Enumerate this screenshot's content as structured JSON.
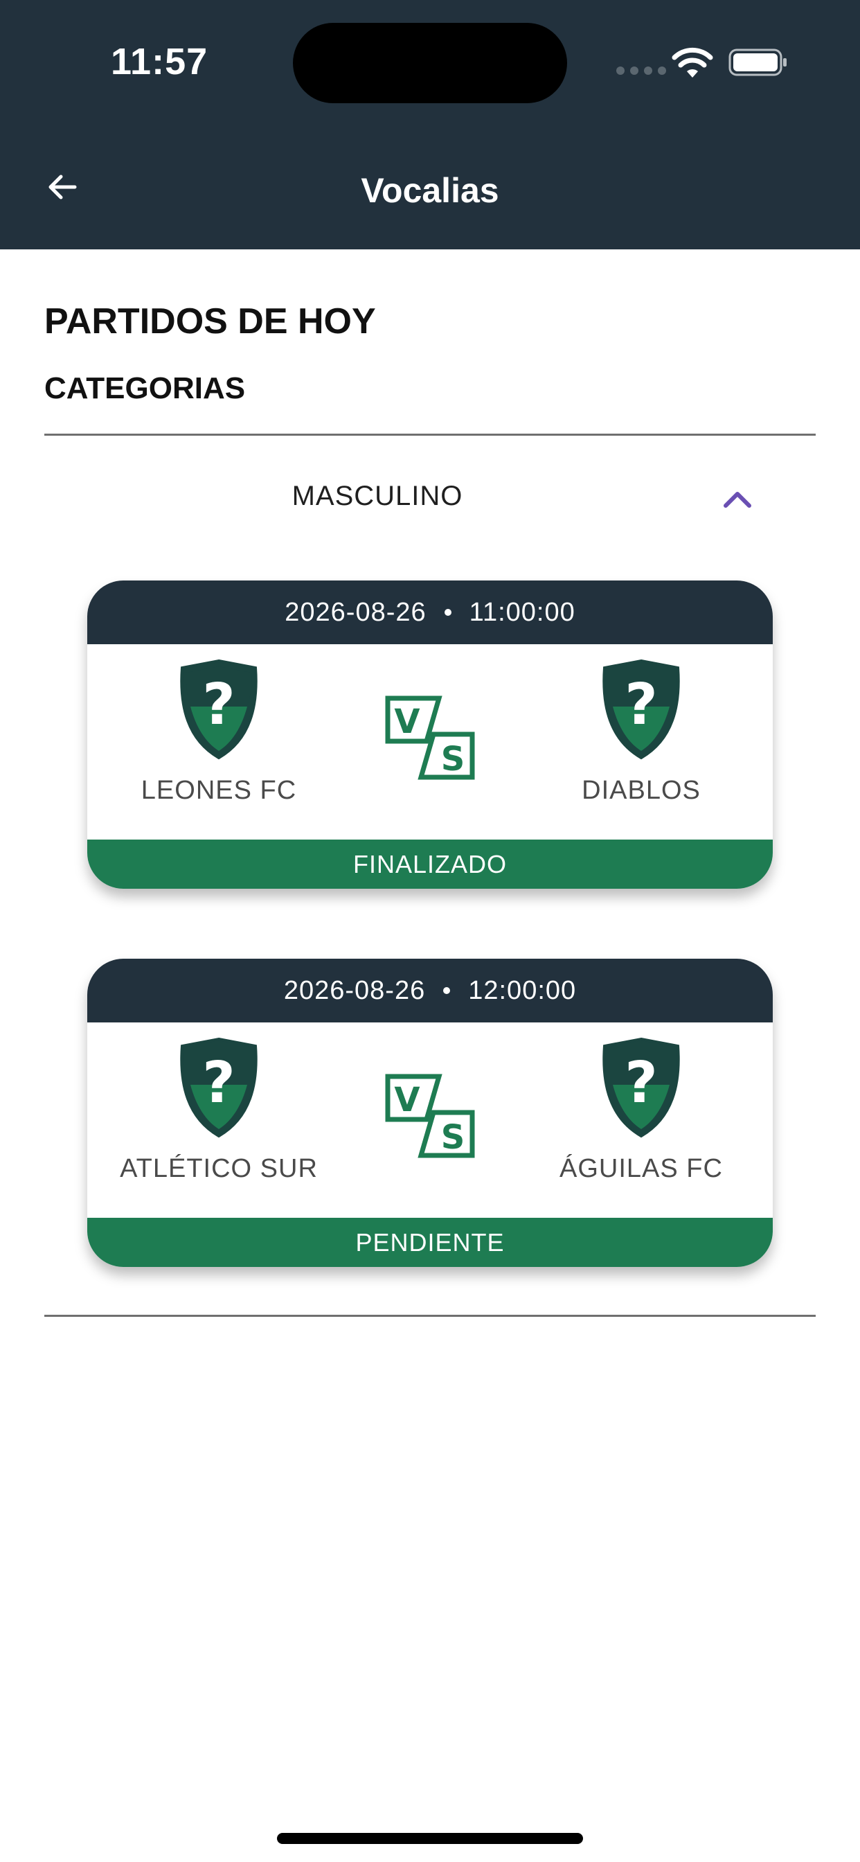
{
  "status": {
    "time": "11:57"
  },
  "header": {
    "title": "Vocalias"
  },
  "main": {
    "title": "PARTIDOS DE HOY",
    "subtitle": "CATEGORIAS",
    "category": {
      "label": "MASCULINO",
      "expanded": true
    },
    "matches": [
      {
        "date": "2026-08-26",
        "time": "11:00:00",
        "home": {
          "name": "LEONES FC"
        },
        "away": {
          "name": "DIABLOS"
        },
        "status": "FINALIZADO"
      },
      {
        "date": "2026-08-26",
        "time": "12:00:00",
        "home": {
          "name": "ATLÉTICO SUR"
        },
        "away": {
          "name": "ÁGUILAS FC"
        },
        "status": "PENDIENTE"
      }
    ]
  },
  "colors": {
    "header_bg": "#22313d",
    "status_green": "#1e7c52",
    "accent_purple": "#6a4fb3"
  }
}
